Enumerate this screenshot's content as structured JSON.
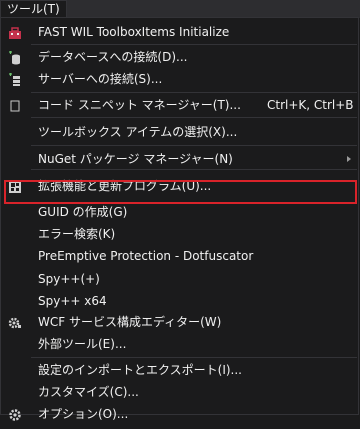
{
  "menubar": {
    "tools_label": "ツール(T)"
  },
  "menu": {
    "items": [
      {
        "label": "FAST WIL ToolboxItems Initialize",
        "icon": "toolbox-icon"
      },
      {
        "label": "データベースへの接続(D)...",
        "icon": "database-connect-icon"
      },
      {
        "label": "サーバーへの接続(S)...",
        "icon": "server-connect-icon"
      },
      {
        "label": "コード スニペット マネージャー(T)...",
        "shortcut": "Ctrl+K, Ctrl+B",
        "icon": "code-snippet-icon"
      },
      {
        "label": "ツールボックス アイテムの選択(X)..."
      },
      {
        "label": "NuGet パッケージ マネージャー(N)",
        "submenu": true
      },
      {
        "label": "拡張機能と更新プログラム(U)...",
        "icon": "extensions-icon",
        "highlighted": true
      },
      {
        "label": "GUID の作成(G)"
      },
      {
        "label": "エラー検索(K)"
      },
      {
        "label": "PreEmptive Protection - Dotfuscator"
      },
      {
        "label": "Spy++(+)"
      },
      {
        "label": "Spy++ x64"
      },
      {
        "label": "WCF サービス構成エディター(W)",
        "icon": "wcf-gear-icon"
      },
      {
        "label": "外部ツール(E)..."
      },
      {
        "label": "設定のインポートとエクスポート(I)..."
      },
      {
        "label": "カスタマイズ(C)..."
      },
      {
        "label": "オプション(O)...",
        "icon": "options-gear-icon"
      }
    ]
  },
  "colors": {
    "background": "#1b1b1c",
    "text": "#f1f1f1",
    "separator": "#333337",
    "highlight_border": "#d9232a"
  }
}
